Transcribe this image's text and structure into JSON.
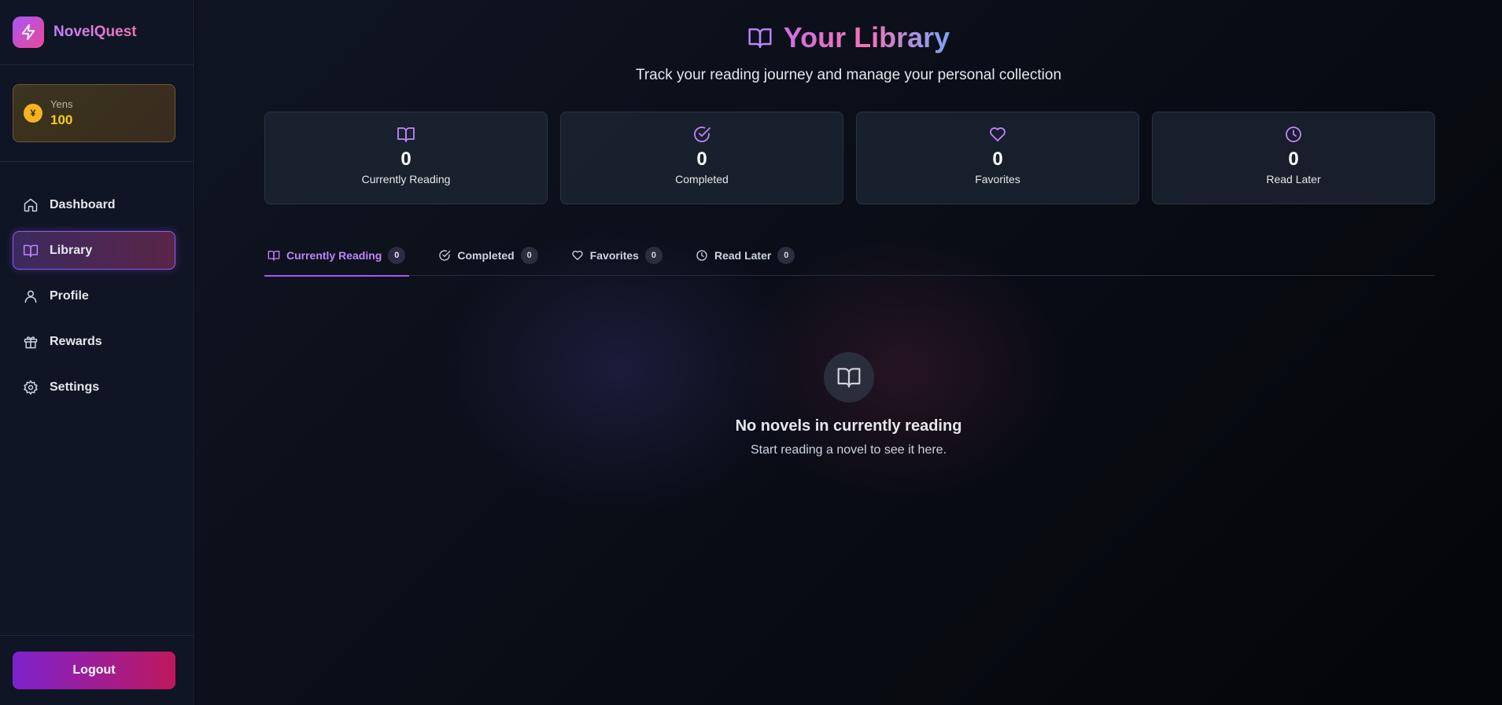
{
  "app": {
    "name": "NovelQuest"
  },
  "wallet": {
    "label": "Yens",
    "value": "100",
    "coin_symbol": "¥"
  },
  "sidebar": {
    "items": [
      {
        "label": "Dashboard",
        "icon": "home-icon"
      },
      {
        "label": "Library",
        "icon": "book-open-icon",
        "active": true
      },
      {
        "label": "Profile",
        "icon": "user-icon"
      },
      {
        "label": "Rewards",
        "icon": "gift-icon"
      },
      {
        "label": "Settings",
        "icon": "gear-icon"
      }
    ],
    "logout_label": "Logout"
  },
  "header": {
    "title": "Your Library",
    "subtitle": "Track your reading journey and manage your personal collection"
  },
  "stats": [
    {
      "value": "0",
      "label": "Currently Reading",
      "icon": "book-open-icon"
    },
    {
      "value": "0",
      "label": "Completed",
      "icon": "check-circle-icon"
    },
    {
      "value": "0",
      "label": "Favorites",
      "icon": "heart-icon"
    },
    {
      "value": "0",
      "label": "Read Later",
      "icon": "clock-icon"
    }
  ],
  "tabs": [
    {
      "label": "Currently Reading",
      "count": "0",
      "icon": "book-open-icon",
      "active": true
    },
    {
      "label": "Completed",
      "count": "0",
      "icon": "check-circle-icon"
    },
    {
      "label": "Favorites",
      "count": "0",
      "icon": "heart-icon"
    },
    {
      "label": "Read Later",
      "count": "0",
      "icon": "clock-icon"
    }
  ],
  "empty_state": {
    "title": "No novels in currently reading",
    "text": "Start reading a novel to see it here."
  },
  "colors": {
    "accent": "#a855f7",
    "brand_pink": "#ec4899",
    "coin": "#f5b324",
    "yens_value": "#facc15"
  }
}
